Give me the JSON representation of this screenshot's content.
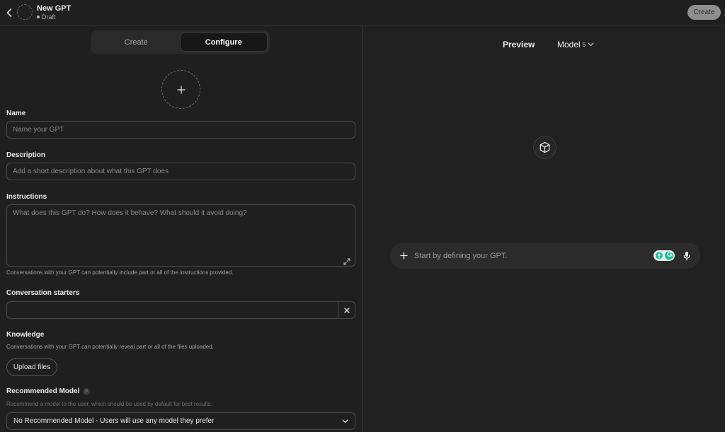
{
  "header": {
    "title": "New GPT",
    "status": "Draft",
    "create_label": "Create"
  },
  "tabs": [
    {
      "label": "Create",
      "active": false
    },
    {
      "label": "Configure",
      "active": true
    }
  ],
  "form": {
    "name": {
      "label": "Name",
      "value": "",
      "placeholder": "Name your GPT"
    },
    "description": {
      "label": "Description",
      "value": "",
      "placeholder": "Add a short description about what this GPT does"
    },
    "instructions": {
      "label": "Instructions",
      "value": "",
      "placeholder": "What does this GPT do? How does it behave? What should it avoid doing?",
      "help": "Conversations with your GPT can potentially include part or all of the instructions provided."
    },
    "starters": {
      "label": "Conversation starters",
      "value": "",
      "placeholder": ""
    },
    "knowledge": {
      "label": "Knowledge",
      "help": "Conversations with your GPT can potentially reveal part or all of the files uploaded.",
      "upload_label": "Upload files"
    },
    "recommended_model": {
      "label": "Recommended Model",
      "help_icon": "?",
      "help": "Recommend a model to the user, which should be used by default for best results.",
      "selected": "No Recommended Model - Users will use any model they prefer"
    }
  },
  "preview": {
    "title": "Preview",
    "model_label": "Model",
    "model_version": "5",
    "composer_placeholder": "Start by defining your GPT.",
    "grammar_letter": "G"
  },
  "colors": {
    "background": "#212121",
    "panel": "#1f1f1f",
    "border": "#4a4a4a",
    "grammarly_green": "#15c39a"
  },
  "icons": [
    "chevron-left-icon",
    "plus-icon",
    "expand-icon",
    "close-icon",
    "chevron-down-icon",
    "cube-icon",
    "microphone-icon",
    "grammarly-icon"
  ]
}
